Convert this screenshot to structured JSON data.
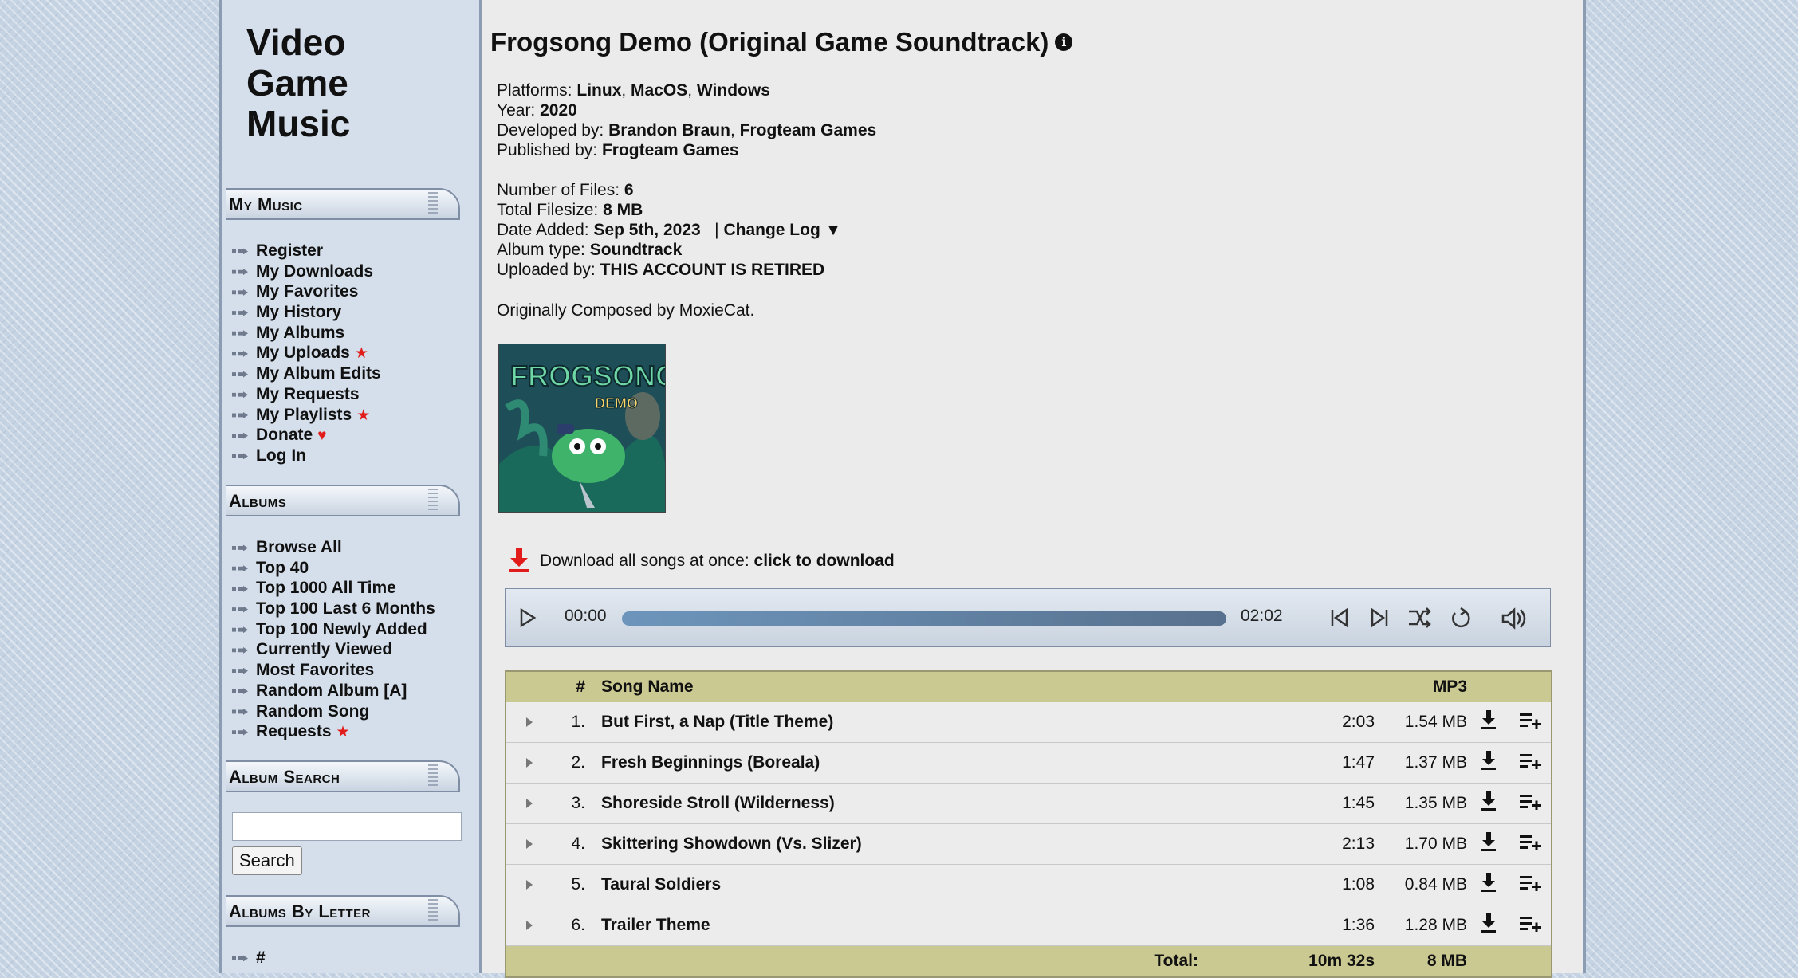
{
  "site_title_lines": [
    "Video",
    "Game",
    "Music"
  ],
  "sidebar": {
    "my_music": {
      "heading": "My Music",
      "items": [
        {
          "label": "Register",
          "mark": ""
        },
        {
          "label": "My Downloads",
          "mark": ""
        },
        {
          "label": "My Favorites",
          "mark": ""
        },
        {
          "label": "My History",
          "mark": ""
        },
        {
          "label": "My Albums",
          "mark": ""
        },
        {
          "label": "My Uploads",
          "mark": "star"
        },
        {
          "label": "My Album Edits",
          "mark": ""
        },
        {
          "label": "My Requests",
          "mark": ""
        },
        {
          "label": "My Playlists",
          "mark": "star"
        },
        {
          "label": "Donate",
          "mark": "heart"
        },
        {
          "label": "Log In",
          "mark": ""
        }
      ]
    },
    "albums": {
      "heading": "Albums",
      "items": [
        {
          "label": "Browse All",
          "mark": ""
        },
        {
          "label": "Top 40",
          "mark": ""
        },
        {
          "label": "Top 1000 All Time",
          "mark": ""
        },
        {
          "label": "Top 100 Last 6 Months",
          "mark": ""
        },
        {
          "label": "Top 100 Newly Added",
          "mark": ""
        },
        {
          "label": "Currently Viewed",
          "mark": ""
        },
        {
          "label": "Most Favorites",
          "mark": ""
        },
        {
          "label": "Random Album [A]",
          "mark": ""
        },
        {
          "label": "Random Song",
          "mark": ""
        },
        {
          "label": "Requests",
          "mark": "star"
        }
      ]
    },
    "album_search": {
      "heading": "Album Search",
      "input_value": "",
      "button_label": "Search"
    },
    "albums_by_letter": {
      "heading": "Albums By Letter",
      "first_item": "#"
    }
  },
  "album": {
    "title": "Frogsong Demo (Original Game Soundtrack)",
    "platforms_label": "Platforms:",
    "platforms": [
      "Linux",
      "MacOS",
      "Windows"
    ],
    "year_label": "Year:",
    "year": "2020",
    "developed_label": "Developed by:",
    "developers": [
      "Brandon Braun",
      "Frogteam Games"
    ],
    "published_label": "Published by:",
    "publisher": "Frogteam Games",
    "files_label": "Number of Files:",
    "files": "6",
    "filesize_label": "Total Filesize:",
    "filesize": "8 MB",
    "date_label": "Date Added:",
    "date": "Sep 5th, 2023",
    "changelog": "Change Log",
    "type_label": "Album type:",
    "type": "Soundtrack",
    "uploader_label": "Uploaded by:",
    "uploader": "THIS ACCOUNT IS RETIRED",
    "note": "Originally Composed by MoxieCat.",
    "cover_text": "FROGSONG",
    "cover_subtext": "DEMO"
  },
  "download": {
    "prefix": "Download all songs at once:",
    "link": "click to download"
  },
  "player": {
    "current_time": "00:00",
    "duration": "02:02",
    "progress_fraction": 0
  },
  "table": {
    "headers": {
      "num": "#",
      "name": "Song Name",
      "mp3": "MP3"
    },
    "songs": [
      {
        "num": "1.",
        "name": "But First, a Nap (Title Theme)",
        "length": "2:03",
        "size": "1.54 MB"
      },
      {
        "num": "2.",
        "name": "Fresh Beginnings (Boreala)",
        "length": "1:47",
        "size": "1.37 MB"
      },
      {
        "num": "3.",
        "name": "Shoreside Stroll (Wilderness)",
        "length": "1:45",
        "size": "1.35 MB"
      },
      {
        "num": "4.",
        "name": "Skittering Showdown (Vs. Slizer)",
        "length": "2:13",
        "size": "1.70 MB"
      },
      {
        "num": "5.",
        "name": "Taural Soldiers",
        "length": "1:08",
        "size": "0.84 MB"
      },
      {
        "num": "6.",
        "name": "Trailer Theme",
        "length": "1:36",
        "size": "1.28 MB"
      }
    ],
    "total_label": "Total:",
    "total_length": "10m 32s",
    "total_size": "8 MB"
  },
  "colors": {
    "table_header": "#cbc992",
    "accent_red": "#e21b1b",
    "sidebar_bg": "#d5dfeb"
  }
}
